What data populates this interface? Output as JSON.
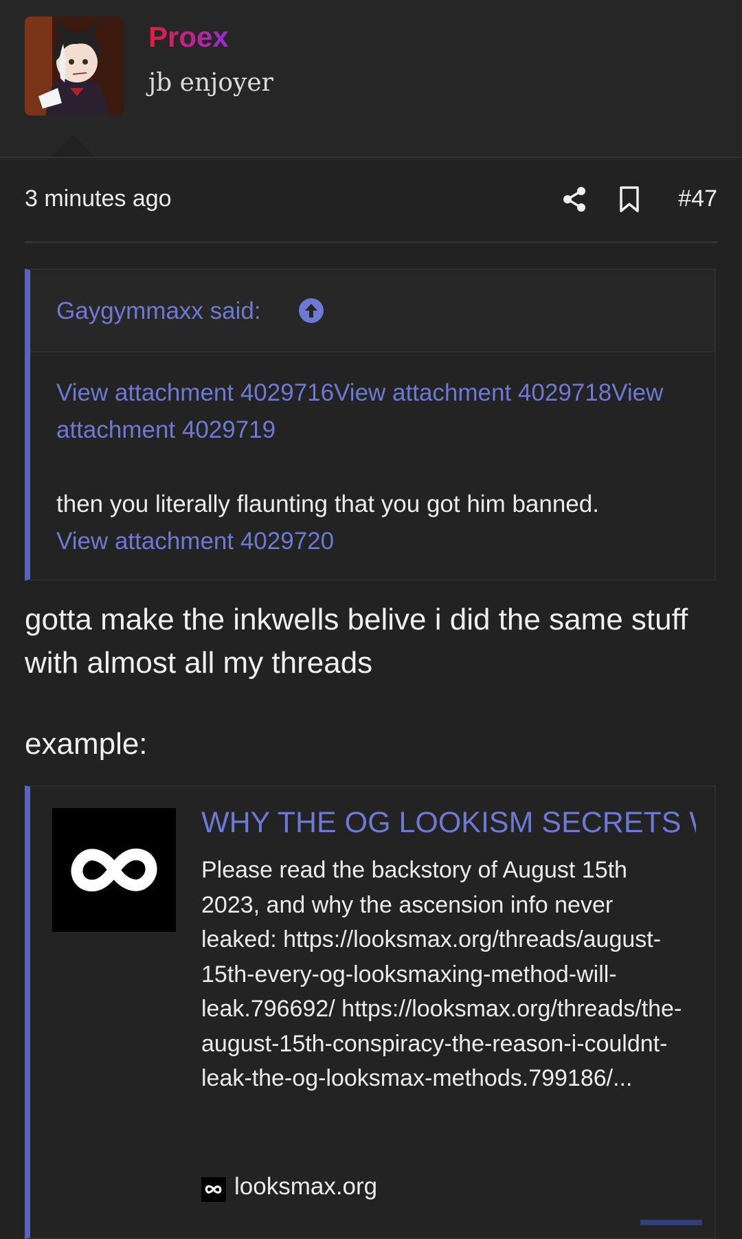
{
  "author": {
    "username": "Proex",
    "user_title": "jb enjoyer"
  },
  "post": {
    "timestamp": "3 minutes ago",
    "number": "#47",
    "quote": {
      "author_line": "Gaygymmaxx said:",
      "attachment_1": "View attachment 4029716",
      "attachment_2": "View attachment 4029718",
      "attachment_3": "View attachment 4029719",
      "text": "then you literally flaunting that you got him banned.",
      "attachment_4": "View attachment 4029720"
    },
    "body_line1": "gotta make the inkwells belive i did the same stuff with almost all my threads",
    "body_line2": "example:",
    "embed": {
      "title": "WHY THE OG LOOKISM SECRETS WILL NEVER BE LEAKED",
      "description": "Please read the backstory of August 15th 2023, and why the ascension info never leaked: https://looksmax.org/threads/august-15th-every-og-looksmaxing-method-will-leak.796692/ https://looksmax.org/threads/the-august-15th-conspiracy-the-reason-i-couldnt-leak-the-og-looksmax-methods.799186/...",
      "source": "looksmax.org"
    }
  },
  "colors": {
    "background": "#222222",
    "link": "#6c7ad4",
    "quote_bar": "#5865c0",
    "username_gradient_start": "#e01e3c",
    "username_gradient_end": "#9b2bd8"
  },
  "icons": {
    "share": "share-icon",
    "bookmark": "bookmark-icon",
    "quote_jump": "arrow-up-circle-icon",
    "site_logo": "infinity-logo-icon"
  }
}
